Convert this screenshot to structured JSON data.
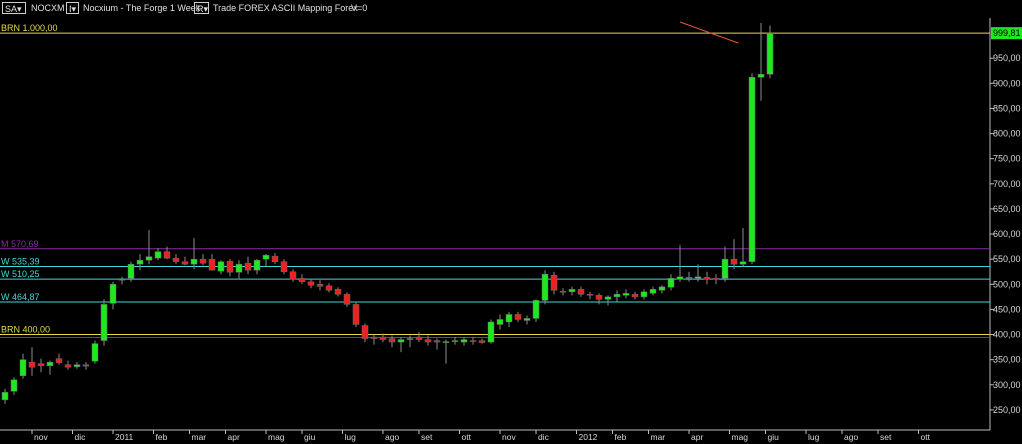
{
  "toolbar": {
    "sa_label": "SA",
    "dropdown_glyph": "▾",
    "symbol": "NOCXM",
    "info_button": "I▾",
    "description": "Nocxium - The Forge  1 Week",
    "r_button": "R▾",
    "menu_text": "Trade  FOREX  ASCII Mapping  Forex",
    "v_label": "V=0"
  },
  "chart_data": {
    "type": "candlestick",
    "ylim": [
      210,
      1030
    ],
    "grid": false,
    "y_ticks": [
      250,
      300,
      350,
      400,
      450,
      500,
      550,
      600,
      650,
      700,
      750,
      800,
      850,
      900,
      950
    ],
    "y_tick_labels": [
      "250,00",
      "300,00",
      "350,00",
      "400,00",
      "450,00",
      "500,00",
      "550,00",
      "600,00",
      "650,00",
      "700,00",
      "750,00",
      "800,00",
      "850,00",
      "900,00",
      "950,00"
    ],
    "x_tick_labels": [
      {
        "label": "ott",
        "i": -2
      },
      {
        "label": "nov",
        "i": 3
      },
      {
        "label": "dic",
        "i": 7.5
      },
      {
        "label": "2011",
        "i": 12
      },
      {
        "label": "feb",
        "i": 16.5
      },
      {
        "label": "mar",
        "i": 20.5
      },
      {
        "label": "apr",
        "i": 24.5
      },
      {
        "label": "mag",
        "i": 29
      },
      {
        "label": "giu",
        "i": 33
      },
      {
        "label": "lug",
        "i": 37.5
      },
      {
        "label": "ago",
        "i": 42
      },
      {
        "label": "set",
        "i": 46
      },
      {
        "label": "ott",
        "i": 50.5
      },
      {
        "label": "nov",
        "i": 55
      },
      {
        "label": "dic",
        "i": 59
      },
      {
        "label": "2012",
        "i": 63.5
      },
      {
        "label": "feb",
        "i": 67.5
      },
      {
        "label": "mar",
        "i": 71.5
      },
      {
        "label": "apr",
        "i": 76
      },
      {
        "label": "mag",
        "i": 80.5
      },
      {
        "label": "giu",
        "i": 84.5
      },
      {
        "label": "lug",
        "i": 89
      },
      {
        "label": "ago",
        "i": 93
      },
      {
        "label": "set",
        "i": 97
      },
      {
        "label": "ott",
        "i": 101.5
      }
    ],
    "last_price_label": "999,81",
    "last_price": 999.81,
    "levels": [
      {
        "name": "BRN 1.000,00",
        "value": 1000,
        "color": "#e8d84a"
      },
      {
        "name": "M 570,69",
        "value": 570.69,
        "color": "#8a2ca0"
      },
      {
        "name": "W 535,39",
        "value": 535.39,
        "color": "#40d8d8"
      },
      {
        "name": "W 510,25",
        "value": 510.25,
        "color": "#40d8d8"
      },
      {
        "name": "W 464,87",
        "value": 464.87,
        "color": "#40d8d8"
      },
      {
        "name": "BRN 400,00",
        "value": 400,
        "color": "#e8d84a"
      },
      {
        "name": "",
        "value": 394,
        "color": "#8a2ca0"
      }
    ],
    "trendline": [
      {
        "i": 75,
        "v": 1022
      },
      {
        "i": 81.5,
        "v": 980
      }
    ],
    "candles": [
      {
        "o": 270,
        "h": 292,
        "l": 262,
        "c": 285
      },
      {
        "o": 287,
        "h": 315,
        "l": 280,
        "c": 310
      },
      {
        "o": 318,
        "h": 362,
        "l": 312,
        "c": 350
      },
      {
        "o": 345,
        "h": 375,
        "l": 318,
        "c": 335
      },
      {
        "o": 342,
        "h": 352,
        "l": 325,
        "c": 338
      },
      {
        "o": 338,
        "h": 348,
        "l": 320,
        "c": 345
      },
      {
        "o": 352,
        "h": 362,
        "l": 340,
        "c": 344
      },
      {
        "o": 340,
        "h": 348,
        "l": 330,
        "c": 335
      },
      {
        "o": 336,
        "h": 345,
        "l": 332,
        "c": 340
      },
      {
        "o": 340,
        "h": 345,
        "l": 330,
        "c": 337
      },
      {
        "o": 347,
        "h": 388,
        "l": 342,
        "c": 382
      },
      {
        "o": 388,
        "h": 470,
        "l": 378,
        "c": 460
      },
      {
        "o": 462,
        "h": 505,
        "l": 450,
        "c": 500
      },
      {
        "o": 508,
        "h": 515,
        "l": 500,
        "c": 510
      },
      {
        "o": 512,
        "h": 545,
        "l": 505,
        "c": 540
      },
      {
        "o": 540,
        "h": 560,
        "l": 528,
        "c": 548
      },
      {
        "o": 548,
        "h": 608,
        "l": 540,
        "c": 555
      },
      {
        "o": 552,
        "h": 572,
        "l": 548,
        "c": 565
      },
      {
        "o": 565,
        "h": 575,
        "l": 550,
        "c": 552
      },
      {
        "o": 552,
        "h": 560,
        "l": 540,
        "c": 545
      },
      {
        "o": 545,
        "h": 555,
        "l": 538,
        "c": 540
      },
      {
        "o": 540,
        "h": 592,
        "l": 530,
        "c": 550
      },
      {
        "o": 550,
        "h": 560,
        "l": 538,
        "c": 542
      },
      {
        "o": 550,
        "h": 560,
        "l": 530,
        "c": 528
      },
      {
        "o": 526,
        "h": 548,
        "l": 520,
        "c": 545
      },
      {
        "o": 546,
        "h": 550,
        "l": 516,
        "c": 524
      },
      {
        "o": 524,
        "h": 548,
        "l": 510,
        "c": 540
      },
      {
        "o": 542,
        "h": 555,
        "l": 520,
        "c": 528
      },
      {
        "o": 528,
        "h": 550,
        "l": 520,
        "c": 548
      },
      {
        "o": 550,
        "h": 560,
        "l": 535,
        "c": 558
      },
      {
        "o": 556,
        "h": 562,
        "l": 540,
        "c": 545
      },
      {
        "o": 545,
        "h": 550,
        "l": 520,
        "c": 525
      },
      {
        "o": 525,
        "h": 530,
        "l": 505,
        "c": 510
      },
      {
        "o": 512,
        "h": 520,
        "l": 500,
        "c": 505
      },
      {
        "o": 505,
        "h": 510,
        "l": 492,
        "c": 498
      },
      {
        "o": 500,
        "h": 508,
        "l": 488,
        "c": 496
      },
      {
        "o": 497,
        "h": 502,
        "l": 484,
        "c": 488
      },
      {
        "o": 490,
        "h": 494,
        "l": 476,
        "c": 480
      },
      {
        "o": 480,
        "h": 484,
        "l": 455,
        "c": 460
      },
      {
        "o": 460,
        "h": 465,
        "l": 415,
        "c": 420
      },
      {
        "o": 418,
        "h": 422,
        "l": 385,
        "c": 392
      },
      {
        "o": 395,
        "h": 400,
        "l": 380,
        "c": 392
      },
      {
        "o": 395,
        "h": 402,
        "l": 385,
        "c": 390
      },
      {
        "o": 392,
        "h": 398,
        "l": 375,
        "c": 385
      },
      {
        "o": 385,
        "h": 395,
        "l": 365,
        "c": 390
      },
      {
        "o": 390,
        "h": 398,
        "l": 375,
        "c": 392
      },
      {
        "o": 395,
        "h": 405,
        "l": 385,
        "c": 390
      },
      {
        "o": 390,
        "h": 398,
        "l": 378,
        "c": 385
      },
      {
        "o": 388,
        "h": 392,
        "l": 370,
        "c": 385
      },
      {
        "o": 384,
        "h": 390,
        "l": 342,
        "c": 386
      },
      {
        "o": 387,
        "h": 395,
        "l": 380,
        "c": 388
      },
      {
        "o": 385,
        "h": 395,
        "l": 378,
        "c": 390
      },
      {
        "o": 388,
        "h": 395,
        "l": 380,
        "c": 386
      },
      {
        "o": 388,
        "h": 392,
        "l": 382,
        "c": 384
      },
      {
        "o": 385,
        "h": 430,
        "l": 382,
        "c": 425
      },
      {
        "o": 420,
        "h": 440,
        "l": 410,
        "c": 430
      },
      {
        "o": 425,
        "h": 445,
        "l": 415,
        "c": 440
      },
      {
        "o": 440,
        "h": 445,
        "l": 425,
        "c": 430
      },
      {
        "o": 428,
        "h": 438,
        "l": 420,
        "c": 432
      },
      {
        "o": 432,
        "h": 470,
        "l": 425,
        "c": 468
      },
      {
        "o": 468,
        "h": 528,
        "l": 460,
        "c": 520
      },
      {
        "o": 518,
        "h": 525,
        "l": 480,
        "c": 488
      },
      {
        "o": 486,
        "h": 492,
        "l": 478,
        "c": 485
      },
      {
        "o": 485,
        "h": 495,
        "l": 478,
        "c": 490
      },
      {
        "o": 490,
        "h": 495,
        "l": 475,
        "c": 480
      },
      {
        "o": 480,
        "h": 485,
        "l": 470,
        "c": 478
      },
      {
        "o": 478,
        "h": 482,
        "l": 460,
        "c": 470
      },
      {
        "o": 470,
        "h": 478,
        "l": 458,
        "c": 475
      },
      {
        "o": 475,
        "h": 488,
        "l": 465,
        "c": 480
      },
      {
        "o": 478,
        "h": 490,
        "l": 472,
        "c": 482
      },
      {
        "o": 480,
        "h": 485,
        "l": 470,
        "c": 475
      },
      {
        "o": 475,
        "h": 490,
        "l": 470,
        "c": 485
      },
      {
        "o": 482,
        "h": 495,
        "l": 478,
        "c": 490
      },
      {
        "o": 488,
        "h": 498,
        "l": 482,
        "c": 495
      },
      {
        "o": 494,
        "h": 520,
        "l": 488,
        "c": 512
      },
      {
        "o": 510,
        "h": 578,
        "l": 505,
        "c": 515
      },
      {
        "o": 514,
        "h": 525,
        "l": 505,
        "c": 512
      },
      {
        "o": 512,
        "h": 540,
        "l": 505,
        "c": 515
      },
      {
        "o": 514,
        "h": 525,
        "l": 500,
        "c": 510
      },
      {
        "o": 512,
        "h": 520,
        "l": 500,
        "c": 510
      },
      {
        "o": 512,
        "h": 575,
        "l": 505,
        "c": 550
      },
      {
        "o": 550,
        "h": 590,
        "l": 530,
        "c": 540
      },
      {
        "o": 540,
        "h": 612,
        "l": 535,
        "c": 545
      },
      {
        "o": 545,
        "h": 920,
        "l": 540,
        "c": 912
      },
      {
        "o": 912,
        "h": 1020,
        "l": 865,
        "c": 918
      },
      {
        "o": 918,
        "h": 1015,
        "l": 910,
        "c": 999.81
      }
    ]
  }
}
